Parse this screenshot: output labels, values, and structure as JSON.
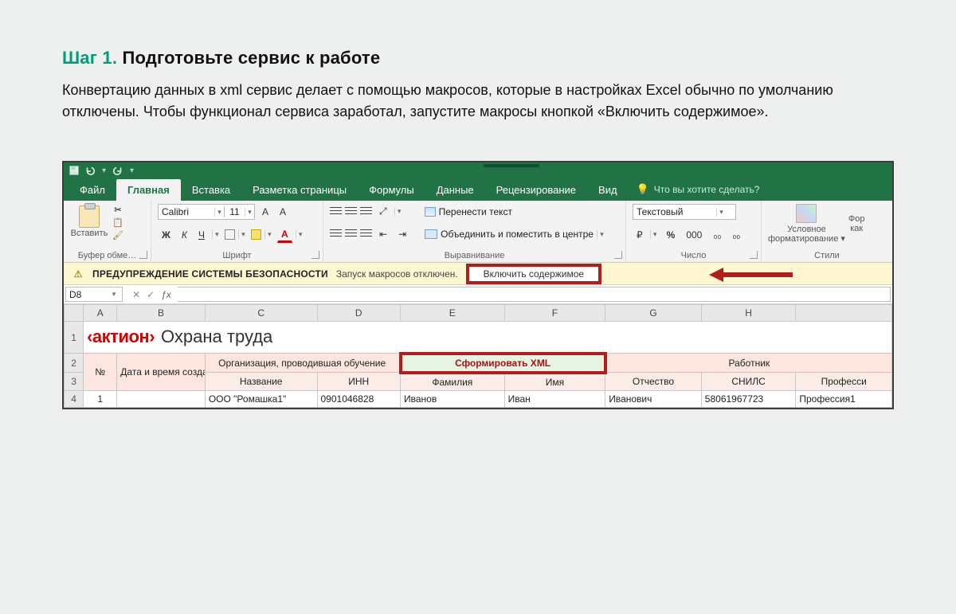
{
  "step": {
    "number": "Шаг 1.",
    "title": "Подготовьте сервис к работе",
    "body": "Конвертацию данных в xml сервис делает с помощью макросов, которые в настройках Excel обычно по умолчанию отключены. Чтобы функционал сервиса заработал, запустите макросы кнопкой «Включить содержимое»."
  },
  "excel": {
    "tabs": {
      "file": "Файл",
      "home": "Главная",
      "insert": "Вставка",
      "pagelayout": "Разметка страницы",
      "formulas": "Формулы",
      "data": "Данные",
      "review": "Рецензирование",
      "view": "Вид",
      "tellme": "Что вы хотите сделать?"
    },
    "ribbon": {
      "paste": "Вставить",
      "clipboard_group": "Буфер обме…",
      "font_name": "Calibri",
      "font_size": "11",
      "font_group": "Шрифт",
      "bold": "Ж",
      "italic": "К",
      "underline": "Ч",
      "bigA": "A",
      "smallA": "A",
      "wrap": "Перенести текст",
      "merge": "Объединить и поместить в центре",
      "align_group": "Выравнивание",
      "numfmt": "Текстовый",
      "currency": "₽",
      "percent": "%",
      "thousands": "000",
      "inc_dec0": "₀₀",
      "inc_dec1": "₀₀",
      "number_group": "Число",
      "condfmt1": "Условное",
      "condfmt2": "форматирование",
      "fmt_as1": "Фор",
      "fmt_as2": "как",
      "styles_group": "Стили"
    },
    "security": {
      "title": "ПРЕДУПРЕЖДЕНИЕ СИСТЕМЫ БЕЗОПАСНОСТИ",
      "msg": "Запуск макросов отключен.",
      "button": "Включить содержимое"
    },
    "namebox": "D8",
    "columns": [
      "A",
      "B",
      "C",
      "D",
      "E",
      "F",
      "G",
      "H"
    ],
    "brand_pre": "‹актион›",
    "brand_post": "Охрана труда",
    "headers": {
      "no": "№",
      "datetime": "Дата и время создания xml",
      "org": "Организация, проводившая обучение",
      "generate": "Сформировать XML",
      "worker": "Работник",
      "name": "Название",
      "inn": "ИНН",
      "surname": "Фамилия",
      "firstname": "Имя",
      "patronymic": "Отчество",
      "snils": "СНИЛС",
      "profession": "Професси"
    },
    "rows": [
      {
        "no": "1",
        "datetime": "",
        "org": "ООО \"Ромашка1\"",
        "inn": "0901046828",
        "surname": "Иванов",
        "firstname": "Иван",
        "patronymic": "Иванович",
        "snils": "58061967723",
        "profession": "Профессия1"
      }
    ]
  }
}
